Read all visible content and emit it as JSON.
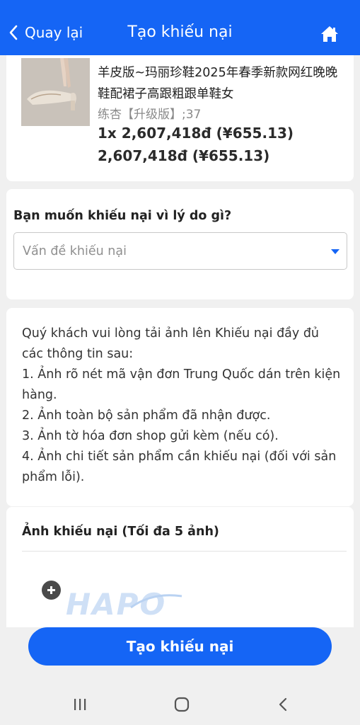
{
  "header": {
    "back_label": "Quay lại",
    "title": "Tạo khiếu nại",
    "back_icon": "chevron-left-icon",
    "home_icon": "home-icon",
    "bg_color": "#1565f5"
  },
  "product": {
    "name": "羊皮版~玛丽珍鞋2025年春季新款网红晚晚鞋配裙子高跟粗跟单鞋女",
    "variant": "练杏【升级版】;37",
    "price_line": "1x 2,607,418đ (¥655.13)",
    "total_line": "2,607,418đ (¥655.13)"
  },
  "reason": {
    "question": "Bạn muốn khiếu nại vì lý do gì?",
    "placeholder": "Vấn đề khiếu nại"
  },
  "instructions": {
    "intro": "Quý khách vui lòng tải ảnh lên Khiếu nại đầy đủ các thông tin sau:",
    "items": [
      "1. Ảnh rõ nét mã vận đơn Trung Quốc dán trên kiện hàng.",
      "2. Ảnh toàn bộ sản phẩm đã nhận được.",
      "3. Ảnh tờ hóa đơn shop gửi kèm (nếu có).",
      "4. Ảnh chi tiết sản phẩm cần khiếu nại (đối với sản phẩm lỗi)."
    ]
  },
  "photos": {
    "label": "Ảnh khiếu nại (Tối đa 5 ảnh)",
    "add_icon": "add-circle-icon",
    "watermark": "HAPO"
  },
  "submit_label": "Tạo khiếu nại",
  "system_nav": {
    "recent_icon": "recent-apps-icon",
    "home_icon": "home-circle-icon",
    "back_icon": "back-chevron-icon"
  }
}
